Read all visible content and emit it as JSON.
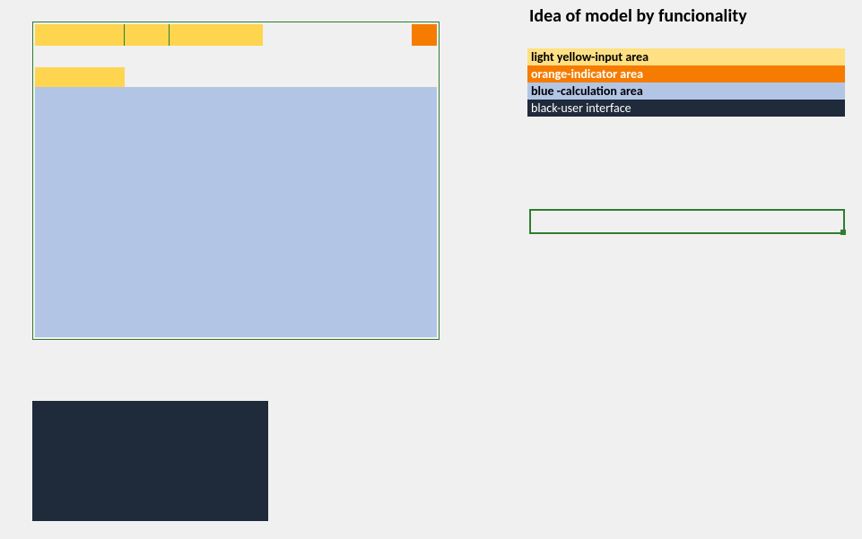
{
  "title": "Idea of model by funcionality",
  "legend": {
    "yellow": "light yellow-input area",
    "orange": "orange-indicator area",
    "blue": "blue -calculation area",
    "black": "black-user interface"
  },
  "colors": {
    "input": "#ffd54f",
    "indicator": "#f57c00",
    "calculation": "#b3c5e5",
    "ui": "#1f2a3a",
    "border": "#2e7d32",
    "background": "#f0f0f0"
  }
}
